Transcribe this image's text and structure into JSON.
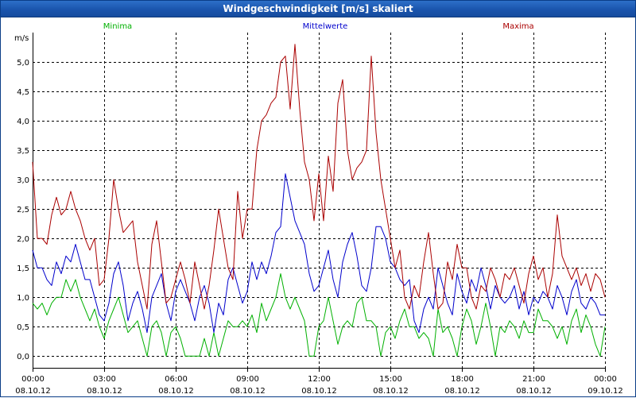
{
  "window": {
    "title": "Windgeschwindigkeit [m/s] skaliert"
  },
  "chart_data": {
    "type": "line",
    "title": "Windgeschwindigkeit [m/s] skaliert",
    "ylabel": "m/s",
    "xlabel": "",
    "ylim": [
      -0.2,
      5.5
    ],
    "xlim": [
      0,
      24
    ],
    "y_ticks": [
      "0,0",
      "0,5",
      "1,0",
      "1,5",
      "2,0",
      "2,5",
      "3,0",
      "3,5",
      "4,0",
      "4,5",
      "5,0"
    ],
    "x_ticks": [
      {
        "time": "00:00",
        "date": "08.10.12"
      },
      {
        "time": "03:00",
        "date": "08.10.12"
      },
      {
        "time": "06:00",
        "date": "08.10.12"
      },
      {
        "time": "09:00",
        "date": "08.10.12"
      },
      {
        "time": "12:00",
        "date": "08.10.12"
      },
      {
        "time": "15:00",
        "date": "08.10.12"
      },
      {
        "time": "18:00",
        "date": "08.10.12"
      },
      {
        "time": "21:00",
        "date": "08.10.12"
      },
      {
        "time": "00:00",
        "date": "09.10.12"
      }
    ],
    "grid": true,
    "legend_position": "top",
    "series": [
      {
        "name": "Minima",
        "color": "#00b000",
        "x": [
          0,
          0.2,
          0.4,
          0.6,
          0.8,
          1,
          1.2,
          1.4,
          1.6,
          1.8,
          2,
          2.2,
          2.4,
          2.6,
          2.8,
          3,
          3.2,
          3.4,
          3.6,
          3.8,
          4,
          4.2,
          4.4,
          4.6,
          4.8,
          5,
          5.2,
          5.4,
          5.6,
          5.8,
          6,
          6.2,
          6.4,
          6.6,
          6.8,
          7,
          7.2,
          7.4,
          7.6,
          7.8,
          8,
          8.2,
          8.4,
          8.6,
          8.8,
          9,
          9.2,
          9.4,
          9.6,
          9.8,
          10,
          10.2,
          10.4,
          10.6,
          10.8,
          11,
          11.2,
          11.4,
          11.6,
          11.8,
          12,
          12.2,
          12.4,
          12.6,
          12.8,
          13,
          13.2,
          13.4,
          13.6,
          13.8,
          14,
          14.2,
          14.4,
          14.6,
          14.8,
          15,
          15.2,
          15.4,
          15.6,
          15.8,
          16,
          16.2,
          16.4,
          16.6,
          16.8,
          17,
          17.2,
          17.4,
          17.6,
          17.8,
          18,
          18.2,
          18.4,
          18.6,
          18.8,
          19,
          19.2,
          19.4,
          19.6,
          19.8,
          20,
          20.2,
          20.4,
          20.6,
          20.8,
          21,
          21.2,
          21.4,
          21.6,
          21.8,
          22,
          22.2,
          22.4,
          22.6,
          22.8,
          23,
          23.2,
          23.4,
          23.6,
          23.8,
          24
        ],
        "values": [
          0.9,
          0.8,
          0.9,
          0.7,
          0.9,
          1.0,
          1.0,
          1.3,
          1.1,
          1.3,
          1.0,
          0.8,
          0.6,
          0.8,
          0.5,
          0.3,
          0.6,
          0.8,
          1.0,
          0.7,
          0.4,
          0.5,
          0.6,
          0.3,
          0.0,
          0.5,
          0.6,
          0.4,
          0.0,
          0.4,
          0.5,
          0.3,
          0.0,
          0.0,
          0.0,
          0.0,
          0.3,
          0.0,
          0.4,
          0.0,
          0.3,
          0.6,
          0.5,
          0.5,
          0.6,
          0.5,
          0.7,
          0.4,
          0.9,
          0.6,
          0.8,
          1.0,
          1.4,
          1.0,
          0.8,
          1.0,
          0.8,
          0.6,
          0.0,
          0.0,
          0.5,
          0.6,
          1.0,
          0.6,
          0.2,
          0.5,
          0.6,
          0.5,
          0.9,
          1.0,
          0.6,
          0.6,
          0.5,
          0.0,
          0.4,
          0.5,
          0.3,
          0.6,
          0.8,
          0.5,
          0.5,
          0.3,
          0.4,
          0.3,
          0.0,
          0.8,
          0.4,
          0.5,
          0.3,
          0.0,
          0.5,
          0.8,
          0.6,
          0.2,
          0.5,
          0.9,
          0.5,
          0.0,
          0.5,
          0.4,
          0.6,
          0.5,
          0.3,
          0.6,
          0.4,
          0.4,
          0.8,
          0.6,
          0.6,
          0.5,
          0.3,
          0.5,
          0.2,
          0.6,
          0.8,
          0.4,
          0.7,
          0.5,
          0.2,
          0.0,
          0.5
        ]
      },
      {
        "name": "Mittelwerte",
        "color": "#0000cc",
        "x": [
          0,
          0.2,
          0.4,
          0.6,
          0.8,
          1,
          1.2,
          1.4,
          1.6,
          1.8,
          2,
          2.2,
          2.4,
          2.6,
          2.8,
          3,
          3.2,
          3.4,
          3.6,
          3.8,
          4,
          4.2,
          4.4,
          4.6,
          4.8,
          5,
          5.2,
          5.4,
          5.6,
          5.8,
          6,
          6.2,
          6.4,
          6.6,
          6.8,
          7,
          7.2,
          7.4,
          7.6,
          7.8,
          8,
          8.2,
          8.4,
          8.6,
          8.8,
          9,
          9.2,
          9.4,
          9.6,
          9.8,
          10,
          10.2,
          10.4,
          10.6,
          10.8,
          11,
          11.2,
          11.4,
          11.6,
          11.8,
          12,
          12.2,
          12.4,
          12.6,
          12.8,
          13,
          13.2,
          13.4,
          13.6,
          13.8,
          14,
          14.2,
          14.4,
          14.6,
          14.8,
          15,
          15.2,
          15.4,
          15.6,
          15.8,
          16,
          16.2,
          16.4,
          16.6,
          16.8,
          17,
          17.2,
          17.4,
          17.6,
          17.8,
          18,
          18.2,
          18.4,
          18.6,
          18.8,
          19,
          19.2,
          19.4,
          19.6,
          19.8,
          20,
          20.2,
          20.4,
          20.6,
          20.8,
          21,
          21.2,
          21.4,
          21.6,
          21.8,
          22,
          22.2,
          22.4,
          22.6,
          22.8,
          23,
          23.2,
          23.4,
          23.6,
          23.8,
          24
        ],
        "values": [
          1.8,
          1.5,
          1.5,
          1.3,
          1.2,
          1.6,
          1.4,
          1.7,
          1.6,
          1.9,
          1.6,
          1.3,
          1.3,
          1.0,
          0.7,
          0.6,
          0.9,
          1.4,
          1.6,
          1.2,
          0.6,
          0.9,
          1.1,
          0.8,
          0.4,
          1.0,
          1.2,
          1.4,
          0.9,
          0.6,
          1.1,
          1.3,
          1.1,
          0.9,
          0.6,
          1.0,
          1.2,
          0.9,
          0.4,
          0.9,
          0.7,
          1.3,
          1.5,
          1.2,
          0.9,
          1.1,
          1.6,
          1.3,
          1.6,
          1.4,
          1.7,
          2.1,
          2.2,
          3.1,
          2.7,
          2.3,
          2.1,
          1.9,
          1.4,
          1.1,
          1.2,
          1.5,
          1.8,
          1.3,
          1.0,
          1.6,
          1.9,
          2.1,
          1.7,
          1.2,
          1.1,
          1.5,
          2.2,
          2.2,
          2.0,
          1.6,
          1.5,
          1.3,
          1.2,
          1.3,
          0.6,
          0.4,
          0.8,
          1.0,
          0.8,
          1.5,
          1.2,
          0.9,
          0.7,
          1.4,
          1.1,
          0.9,
          1.3,
          1.1,
          1.5,
          1.2,
          0.8,
          1.2,
          1.0,
          0.9,
          1.0,
          1.2,
          0.8,
          1.1,
          0.7,
          1.0,
          0.9,
          1.1,
          1.0,
          0.8,
          1.2,
          1.0,
          0.7,
          1.1,
          1.3,
          0.9,
          0.8,
          1.0,
          0.9,
          0.7,
          0.7
        ]
      },
      {
        "name": "Maxima",
        "color": "#aa0000",
        "x": [
          0,
          0.2,
          0.4,
          0.6,
          0.8,
          1,
          1.2,
          1.4,
          1.6,
          1.8,
          2,
          2.2,
          2.4,
          2.6,
          2.8,
          3,
          3.2,
          3.4,
          3.6,
          3.8,
          4,
          4.2,
          4.4,
          4.6,
          4.8,
          5,
          5.2,
          5.4,
          5.6,
          5.8,
          6,
          6.2,
          6.4,
          6.6,
          6.8,
          7,
          7.2,
          7.4,
          7.6,
          7.8,
          8,
          8.2,
          8.4,
          8.6,
          8.8,
          9,
          9.2,
          9.4,
          9.6,
          9.8,
          10,
          10.2,
          10.4,
          10.6,
          10.8,
          11,
          11.2,
          11.4,
          11.6,
          11.8,
          12,
          12.2,
          12.4,
          12.6,
          12.8,
          13,
          13.2,
          13.4,
          13.6,
          13.8,
          14,
          14.2,
          14.4,
          14.6,
          14.8,
          15,
          15.2,
          15.4,
          15.6,
          15.8,
          16,
          16.2,
          16.4,
          16.6,
          16.8,
          17,
          17.2,
          17.4,
          17.6,
          17.8,
          18,
          18.2,
          18.4,
          18.6,
          18.8,
          19,
          19.2,
          19.4,
          19.6,
          19.8,
          20,
          20.2,
          20.4,
          20.6,
          20.8,
          21,
          21.2,
          21.4,
          21.6,
          21.8,
          22,
          22.2,
          22.4,
          22.6,
          22.8,
          23,
          23.2,
          23.4,
          23.6,
          23.8,
          24
        ],
        "values": [
          3.3,
          2.0,
          2.0,
          1.9,
          2.4,
          2.7,
          2.4,
          2.5,
          2.8,
          2.5,
          2.3,
          2.0,
          1.8,
          2.0,
          1.2,
          1.3,
          2.0,
          3.0,
          2.5,
          2.1,
          2.2,
          2.3,
          1.6,
          1.2,
          0.8,
          1.9,
          2.3,
          1.6,
          0.9,
          1.0,
          1.3,
          1.6,
          1.3,
          0.9,
          1.6,
          1.2,
          0.8,
          1.2,
          1.8,
          2.5,
          2.0,
          1.5,
          1.3,
          2.8,
          2.0,
          2.5,
          2.5,
          3.5,
          4.0,
          4.1,
          4.3,
          4.4,
          5.0,
          5.1,
          4.2,
          5.3,
          4.2,
          3.3,
          3.0,
          2.3,
          3.1,
          2.3,
          3.4,
          2.8,
          4.3,
          4.7,
          3.5,
          3.0,
          3.2,
          3.3,
          3.5,
          5.1,
          3.8,
          3.0,
          2.5,
          2.0,
          1.5,
          1.8,
          1.0,
          0.8,
          1.2,
          1.0,
          1.6,
          2.1,
          1.4,
          0.8,
          0.9,
          1.6,
          1.3,
          1.9,
          1.5,
          1.5,
          1.0,
          0.8,
          1.2,
          1.1,
          1.5,
          1.3,
          1.0,
          1.4,
          1.3,
          1.5,
          1.2,
          0.9,
          1.4,
          1.7,
          1.3,
          1.5,
          1.0,
          1.4,
          2.4,
          1.7,
          1.5,
          1.3,
          1.5,
          1.2,
          1.4,
          1.1,
          1.4,
          1.3,
          1.0
        ]
      }
    ]
  }
}
